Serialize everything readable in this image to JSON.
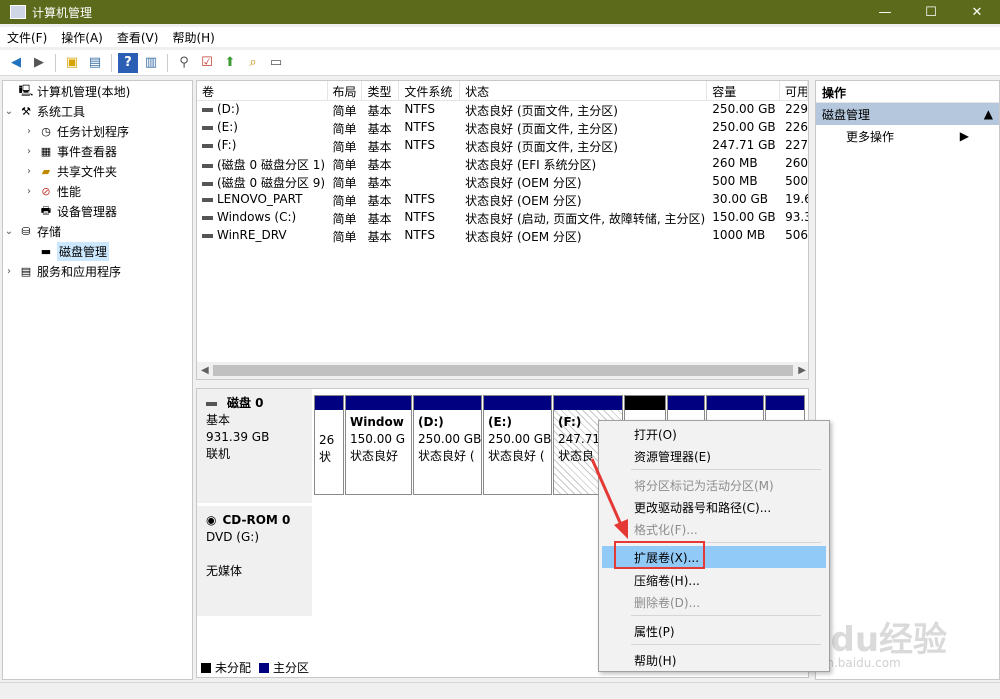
{
  "window": {
    "title": "计算机管理",
    "controls": [
      "—",
      "☐",
      "✕"
    ]
  },
  "menu": [
    "文件(F)",
    "操作(A)",
    "查看(V)",
    "帮助(H)"
  ],
  "tree": {
    "root": "计算机管理(本地)",
    "system_tools": "系统工具",
    "task_scheduler": "任务计划程序",
    "event_viewer": "事件查看器",
    "shared_folders": "共享文件夹",
    "performance": "性能",
    "device_manager": "设备管理器",
    "storage": "存储",
    "disk_management": "磁盘管理",
    "services_apps": "服务和应用程序"
  },
  "volumes": {
    "headers": [
      "卷",
      "布局",
      "类型",
      "文件系统",
      "状态",
      "容量",
      "可用"
    ],
    "rows": [
      [
        "(D:)",
        "简单",
        "基本",
        "NTFS",
        "状态良好 (页面文件, 主分区)",
        "250.00 GB",
        "229."
      ],
      [
        "(E:)",
        "简单",
        "基本",
        "NTFS",
        "状态良好 (页面文件, 主分区)",
        "250.00 GB",
        "226."
      ],
      [
        "(F:)",
        "简单",
        "基本",
        "NTFS",
        "状态良好 (页面文件, 主分区)",
        "247.71 GB",
        "227."
      ],
      [
        "(磁盘 0 磁盘分区 1)",
        "简单",
        "基本",
        "",
        "状态良好 (EFI 系统分区)",
        "260 MB",
        "260"
      ],
      [
        "(磁盘 0 磁盘分区 9)",
        "简单",
        "基本",
        "",
        "状态良好 (OEM 分区)",
        "500 MB",
        "500"
      ],
      [
        "LENOVO_PART",
        "简单",
        "基本",
        "NTFS",
        "状态良好 (OEM 分区)",
        "30.00 GB",
        "19.6"
      ],
      [
        "Windows (C:)",
        "简单",
        "基本",
        "NTFS",
        "状态良好 (启动, 页面文件, 故障转储, 主分区)",
        "150.00 GB",
        "93.3"
      ],
      [
        "WinRE_DRV",
        "简单",
        "基本",
        "NTFS",
        "状态良好 (OEM 分区)",
        "1000 MB",
        "506"
      ]
    ]
  },
  "disk0": {
    "name": "磁盘 0",
    "type": "基本",
    "size": "931.39 GB",
    "status": "联机",
    "partitions": [
      {
        "l1": "",
        "l2": "26",
        "l3": "状"
      },
      {
        "l1": "Window",
        "l2": "150.00 G",
        "l3": "状态良好"
      },
      {
        "l1": "(D:)",
        "l2": "250.00 GB",
        "l3": "状态良好 ("
      },
      {
        "l1": "(E:)",
        "l2": "250.00 GB",
        "l3": "状态良好 ("
      },
      {
        "l1": "(F:)",
        "l2": "247.71",
        "l3": "状态良"
      }
    ]
  },
  "cdrom": {
    "name": "CD-ROM 0",
    "drive": "DVD (G:)",
    "media": "无媒体"
  },
  "legend": {
    "unallocated": "未分配",
    "primary": "主分区"
  },
  "actions": {
    "header": "操作",
    "section": "磁盘管理",
    "more": "更多操作"
  },
  "context_menu": {
    "open": "打开(O)",
    "explorer": "资源管理器(E)",
    "mark_active": "将分区标记为活动分区(M)",
    "change_letter": "更改驱动器号和路径(C)...",
    "format": "格式化(F)...",
    "extend": "扩展卷(X)...",
    "shrink": "压缩卷(H)...",
    "delete": "删除卷(D)...",
    "properties": "属性(P)",
    "help": "帮助(H)"
  },
  "watermark": {
    "logo": "Baidu经验",
    "url": "jingyan.baidu.com"
  },
  "colors": {
    "titlebar": "#5c6b1b",
    "primary_partition": "#000080",
    "highlight": "#91c9f7",
    "annotation": "#e53935"
  }
}
